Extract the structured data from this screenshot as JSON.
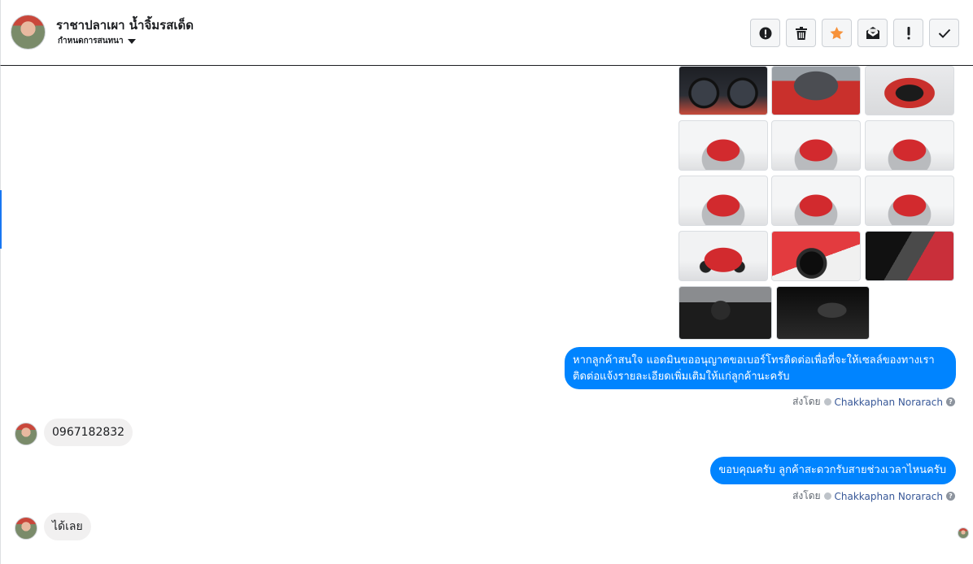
{
  "header": {
    "contact_name": "ราชาปลาเผา น้ำจิ้มรสเด็ด",
    "subtitle": "กำหนดการสนทนา",
    "actions": [
      {
        "name": "alert-circle-button",
        "icon": "alert-circle-icon"
      },
      {
        "name": "delete-button",
        "icon": "trash-icon"
      },
      {
        "name": "star-button",
        "icon": "star-icon",
        "color": "#f7923a"
      },
      {
        "name": "mark-unread-button",
        "icon": "envelope-icon"
      },
      {
        "name": "important-button",
        "icon": "exclamation-icon"
      },
      {
        "name": "mark-done-button",
        "icon": "check-icon"
      }
    ]
  },
  "colors": {
    "outgoing_bubble": "#0084ff",
    "incoming_bubble": "#f1f0f0",
    "agent_link": "#385898",
    "star": "#f7923a"
  },
  "photos": [
    "dashboard",
    "engine",
    "trunk",
    "front",
    "front",
    "front",
    "rear",
    "rear",
    "rear",
    "side",
    "wheel",
    "door",
    "interior",
    "gear-shift"
  ],
  "messages": [
    {
      "direction": "out",
      "lines": [
        "หากลูกค้าสนใจ แอดมินขออนุญาตขอเบอร์โทรติดต่อเพื่อที่จะให้เซลล์ของทางเรา",
        "ติดต่อแจ้งรายละเอียดเพิ่มเติมให้แก่ลูกค้านะครับ"
      ]
    },
    {
      "direction": "in",
      "text": "0967182832"
    },
    {
      "direction": "out",
      "lines": [
        "ขอบคุณครับ ลูกค้าสะดวกรับสายช่วงเวลาไหนครับ"
      ]
    },
    {
      "direction": "in",
      "text": "ได้เลย"
    }
  ],
  "sent_by": {
    "prefix": "ส่งโดย",
    "agent": "Chakkaphan Norarach",
    "help": "?"
  }
}
